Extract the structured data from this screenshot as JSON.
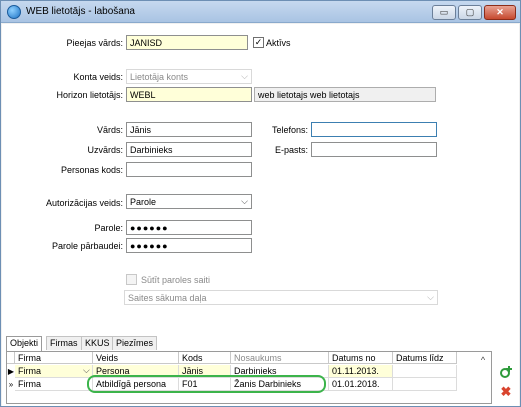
{
  "window": {
    "title": "WEB lietotājs - labošana",
    "controls": {
      "minimize": "▭",
      "maximize": "▢",
      "close": "✕"
    }
  },
  "form": {
    "login_label": "Pieejas vārds:",
    "login_value": "JANISD",
    "active_label": "Aktīvs",
    "active_checked": "✓",
    "account_type_label": "Konta veids:",
    "account_type_value": "Lietotāja konts",
    "horizon_user_label": "Horizon lietotājs:",
    "horizon_user_value": "WEBL",
    "horizon_user_desc": "web lietotajs web lietotajs",
    "first_name_label": "Vārds:",
    "first_name_value": "Jānis",
    "last_name_label": "Uzvārds:",
    "last_name_value": "Darbinieks",
    "personal_code_label": "Personas kods:",
    "personal_code_value": "",
    "phone_label": "Telefons:",
    "phone_value": "",
    "email_label": "E-pasts:",
    "email_value": "",
    "auth_type_label": "Autorizācijas veids:",
    "auth_type_value": "Parole",
    "password_label": "Parole:",
    "password_value": "●●●●●●",
    "password_confirm_label": "Parole pārbaudei:",
    "password_confirm_value": "●●●●●●",
    "send_link_label": "Sūtīt paroles saiti",
    "start_page_placeholder": "Saites sākuma daļa"
  },
  "tabs": [
    "Objekti",
    "Firmas",
    "KKUS",
    "Piezīmes"
  ],
  "grid": {
    "columns": [
      "Firma",
      "Veids",
      "Kods",
      "Nosaukums",
      "Datums no",
      "Datums līdz"
    ],
    "rows": [
      {
        "indicator": "▶",
        "firma": "Firma",
        "veids": "Persona",
        "kods": "Jānis",
        "nosaukums": "Darbinieks",
        "datums_no": "01.11.2013.",
        "datums_lidz": ""
      },
      {
        "indicator": "»",
        "firma": "Firma",
        "veids": "Atbildīgā persona",
        "kods": "F01",
        "nosaukums": "Žanis Darbinieks",
        "datums_no": "01.01.2018.",
        "datums_lidz": ""
      }
    ]
  },
  "icons": {
    "scroll_up": "^",
    "add": "add-icon",
    "delete": "delete-icon"
  },
  "colors": {
    "title_bar": "#a9c4e3",
    "required_field": "#ffffd9",
    "highlight": "#3cb44b",
    "delete_red": "#d9442e",
    "add_green": "#2e9b3c"
  }
}
